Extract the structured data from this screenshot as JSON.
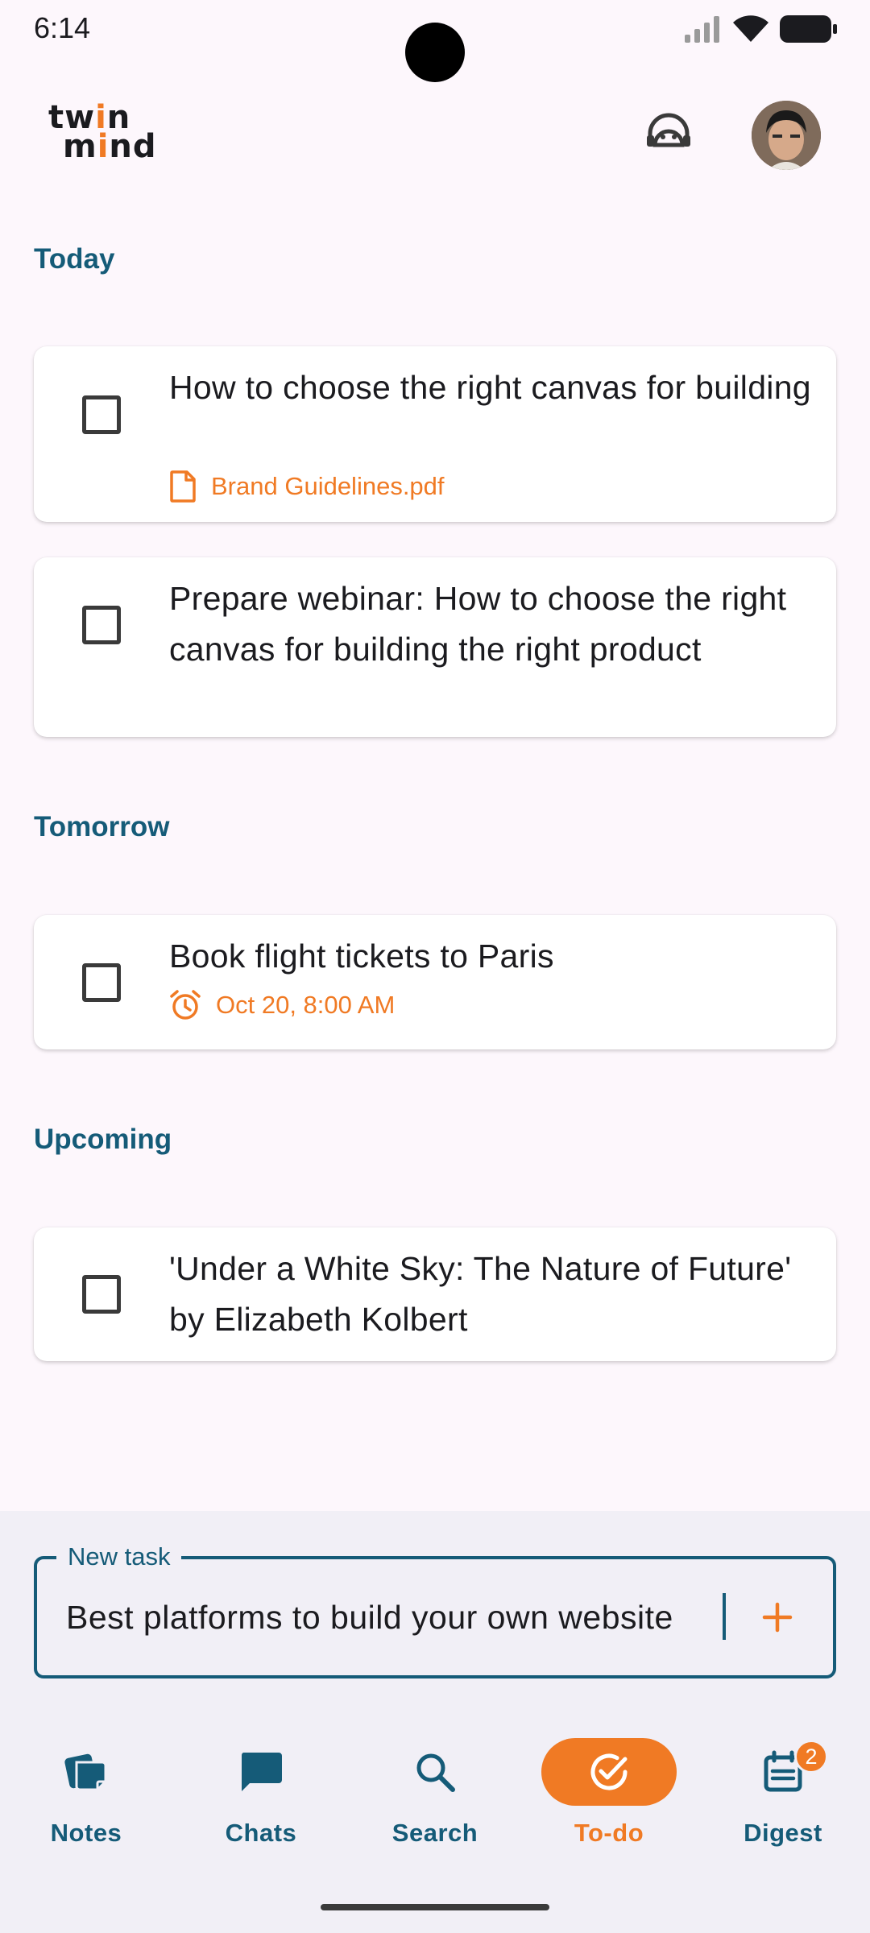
{
  "status_bar": {
    "time": "6:14"
  },
  "header": {
    "logo_line1_a": "tw",
    "logo_line1_b": "i",
    "logo_line1_c": "n",
    "logo_line2_a": "m",
    "logo_line2_b": "i",
    "logo_line2_c": "nd"
  },
  "sections": {
    "today": {
      "title": "Today",
      "tasks": [
        {
          "text": "How to choose the right canvas for building",
          "attachment": "Brand Guidelines.pdf"
        },
        {
          "text": "Prepare webinar: How to choose the right canvas for building the right product"
        }
      ]
    },
    "tomorrow": {
      "title": "Tomorrow",
      "tasks": [
        {
          "text": "Book flight tickets to Paris",
          "reminder": "Oct 20, 8:00 AM"
        }
      ]
    },
    "upcoming": {
      "title": "Upcoming",
      "tasks": [
        {
          "text": "'Under a White Sky: The Nature of Future' by Elizabeth Kolbert"
        }
      ]
    }
  },
  "new_task": {
    "legend": "New task",
    "value": "Best platforms to build your own website"
  },
  "nav": {
    "items": [
      {
        "label": "Notes",
        "icon": "notes-icon"
      },
      {
        "label": "Chats",
        "icon": "chat-icon"
      },
      {
        "label": "Search",
        "icon": "search-icon"
      },
      {
        "label": "To-do",
        "icon": "check-circle-icon",
        "active": true
      },
      {
        "label": "Digest",
        "icon": "digest-icon",
        "badge": "2"
      }
    ]
  },
  "colors": {
    "accent": "#f07a24",
    "primary": "#155b78",
    "background": "#fdf7fc"
  }
}
